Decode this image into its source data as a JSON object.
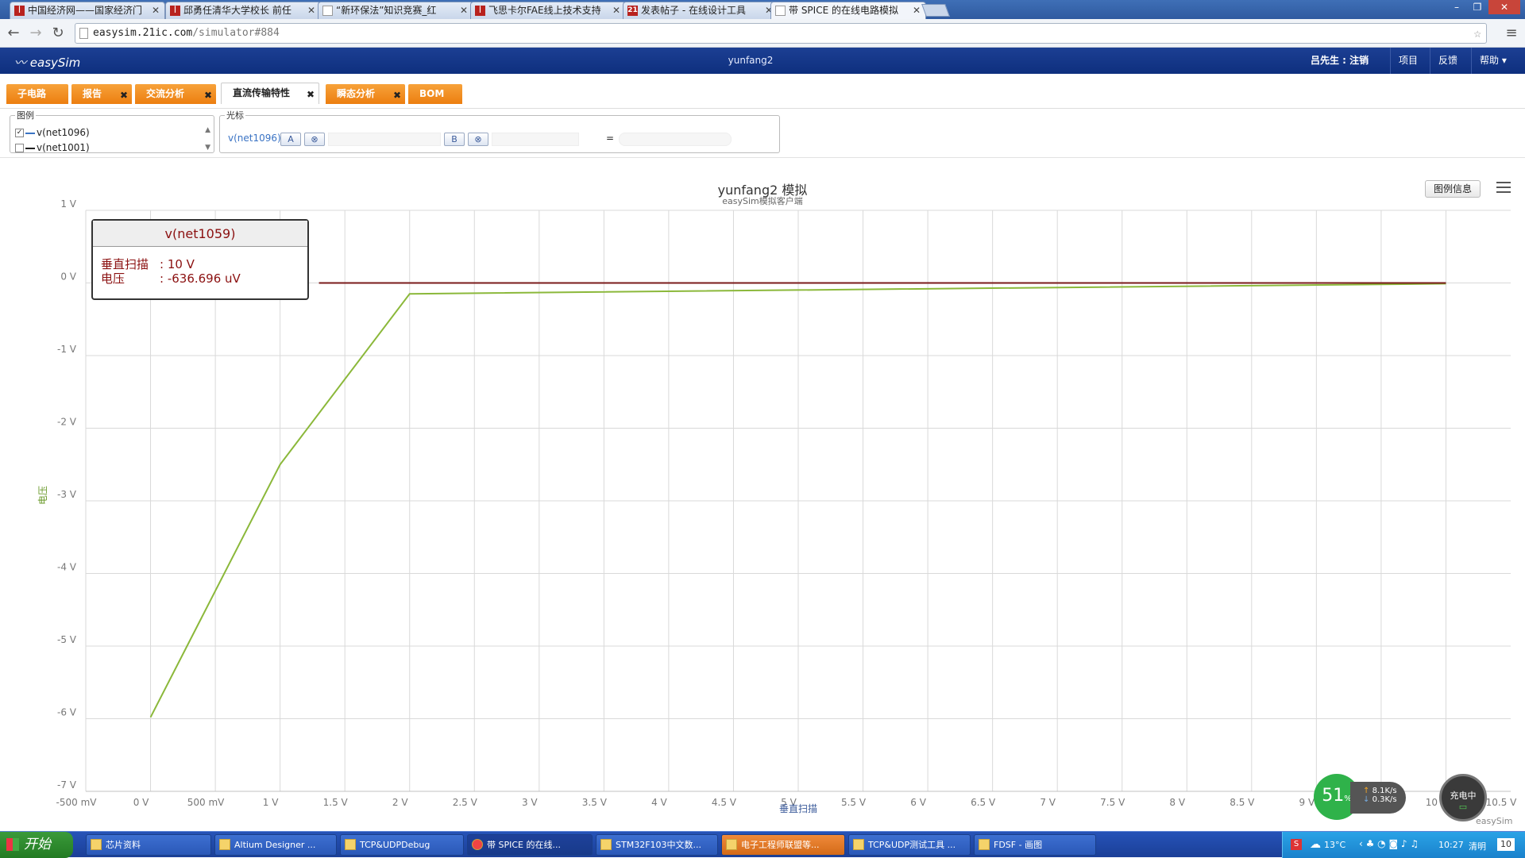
{
  "browser": {
    "tabs": [
      {
        "title": "中国经济网——国家经济门",
        "icon": "page-icon"
      },
      {
        "title": "邱勇任清华大学校长 前任",
        "icon": "page-icon"
      },
      {
        "title": "“新环保法”知识竞赛_红",
        "icon": "doc-icon"
      },
      {
        "title": "飞思卡尔FAE线上技术支持",
        "icon": "page-icon"
      },
      {
        "title": "发表帖子 - 在线设计工具",
        "icon": "page-icon"
      },
      {
        "title": "带 SPICE 的在线电路模拟",
        "icon": "doc-icon"
      }
    ],
    "url_host": "easysim.21ic.com",
    "url_path": "/simulator#884"
  },
  "app": {
    "logo": "easySim",
    "title": "yunfang2",
    "user": "吕先生 : 注销",
    "menu": [
      "项目",
      "反馈",
      "帮助"
    ]
  },
  "analysis_tabs": [
    {
      "label": "子电路",
      "closable": false,
      "active": false
    },
    {
      "label": "报告",
      "closable": true,
      "active": false
    },
    {
      "label": "交流分析",
      "closable": true,
      "active": false
    },
    {
      "label": "直流传输特性",
      "closable": true,
      "active": true
    },
    {
      "label": "瞬态分析",
      "closable": true,
      "active": false
    },
    {
      "label": "BOM",
      "closable": false,
      "active": false
    }
  ],
  "legend_panel": {
    "title": "图例",
    "items": [
      {
        "label": "v(net1096)",
        "checked": true,
        "color": "#3a73c4"
      },
      {
        "label": "v(net1001)",
        "checked": false,
        "color": "#222222"
      }
    ]
  },
  "cursor_panel": {
    "title": "光标",
    "signal": "v(net1096)",
    "btn_a": "A",
    "btn_b": "B",
    "clear": "⊗",
    "equals": "="
  },
  "chart_data": {
    "type": "line",
    "title": "yunfang2 模拟",
    "subtitle": "easySim模拟客户端",
    "xlabel": "垂直扫描",
    "ylabel": "电压",
    "xlim": [
      -0.5,
      10.5
    ],
    "ylim": [
      -7,
      1
    ],
    "x_ticks": [
      "-500 mV",
      "0 V",
      "500 mV",
      "1 V",
      "1.5 V",
      "2 V",
      "2.5 V",
      "3 V",
      "3.5 V",
      "4 V",
      "4.5 V",
      "5 V",
      "5.5 V",
      "6 V",
      "6.5 V",
      "7 V",
      "7.5 V",
      "8 V",
      "8.5 V",
      "9 V",
      "9.5 V",
      "10 V",
      "10.5 V"
    ],
    "y_ticks": [
      "1 V",
      "0 V",
      "-1 V",
      "-2 V",
      "-3 V",
      "-4 V",
      "-5 V",
      "-6 V",
      "-7 V"
    ],
    "series": [
      {
        "color": "#8bb83a",
        "x": [
          0,
          1,
          2,
          10
        ],
        "y": [
          -5.98,
          -2.5,
          -0.15,
          -0.01
        ]
      },
      {
        "color": "#7a1a1a",
        "x": [
          1.3,
          10
        ],
        "y": [
          0,
          0
        ]
      }
    ],
    "legend_button": "图例信息",
    "tooltip": {
      "title": "v(net1059)",
      "row1_label": "垂直扫描",
      "row1_value": "10 V",
      "row2_label": "电压",
      "row2_value": "-636.696 uV"
    },
    "watermark": "easySim"
  },
  "overlay": {
    "percent": "51",
    "percent_unit": "%",
    "up_rate": "8.1",
    "down_rate": "0.3",
    "rate_unit": "K/s",
    "charging": "充电中"
  },
  "taskbar": {
    "start": "开始",
    "items": [
      {
        "label": "芯片资料",
        "state": "normal"
      },
      {
        "label": "Altium Designer ...",
        "state": "normal"
      },
      {
        "label": "TCP&UDPDebug",
        "state": "normal"
      },
      {
        "label": "带 SPICE 的在线...",
        "state": "active"
      },
      {
        "label": "STM32F103中文数...",
        "state": "normal"
      },
      {
        "label": "电子工程师联盟等...",
        "state": "hl"
      },
      {
        "label": "TCP&UDP测试工具 ...",
        "state": "normal"
      },
      {
        "label": "FDSF - 画图",
        "state": "normal"
      }
    ],
    "temperature": "13°C",
    "time": "10:27",
    "weather": "清明",
    "date_num": "10"
  }
}
